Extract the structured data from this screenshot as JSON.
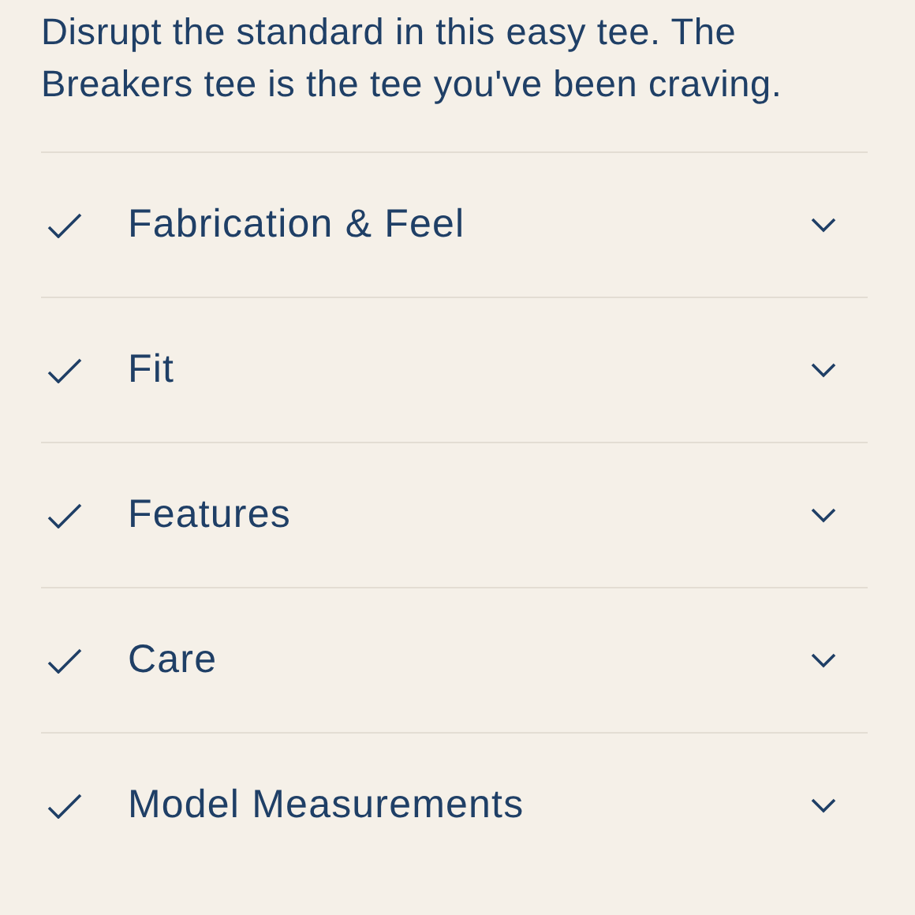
{
  "description": "Disrupt the standard in this easy tee. The Breakers tee is the tee you've been craving.",
  "accordion": [
    {
      "label": "Fabrication & Feel",
      "expanded": false
    },
    {
      "label": "Fit",
      "expanded": false
    },
    {
      "label": "Features",
      "expanded": false
    },
    {
      "label": "Care",
      "expanded": false
    },
    {
      "label": "Model Measurements",
      "expanded": false
    }
  ]
}
